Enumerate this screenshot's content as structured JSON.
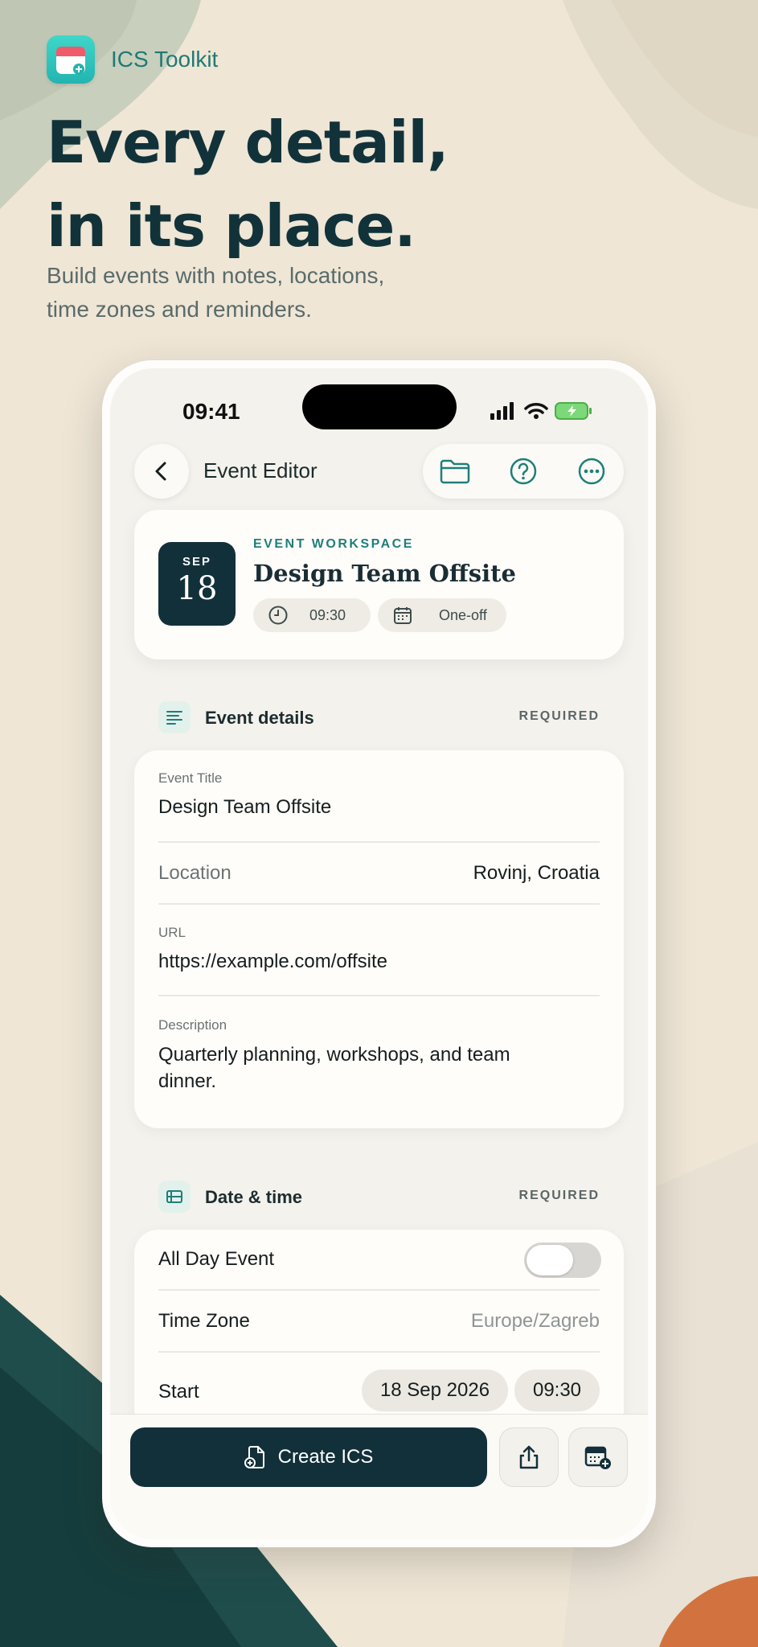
{
  "brand": {
    "name": "ICS Toolkit"
  },
  "headline": {
    "line1": "Every detail,",
    "line2": "in its place."
  },
  "subheadline": {
    "line1": "Build events with notes, locations,",
    "line2": "time zones and reminders."
  },
  "status_bar": {
    "time": "09:41"
  },
  "nav": {
    "title": "Event Editor"
  },
  "hero": {
    "month": "SEP",
    "day": "18",
    "label": "EVENT WORKSPACE",
    "title": "Design Team Offsite",
    "time_chip": "09:30",
    "repeat_chip": "One-off"
  },
  "event_details": {
    "section_title": "Event details",
    "badge": "REQUIRED",
    "title_label": "Event Title",
    "title_value": "Design Team Offsite",
    "location_label": "Location",
    "location_value": "Rovinj, Croatia",
    "url_label": "URL",
    "url_value": "https://example.com/offsite",
    "description_label": "Description",
    "description_line1": "Quarterly planning, workshops, and team",
    "description_line2": "dinner."
  },
  "date_time": {
    "section_title": "Date & time",
    "badge": "REQUIRED",
    "all_day_label": "All Day Event",
    "all_day_on": false,
    "time_zone_label": "Time Zone",
    "time_zone_value": "Europe/Zagreb",
    "start_label": "Start",
    "start_date": "18 Sep 2026",
    "start_time": "09:30"
  },
  "bottom": {
    "create_label": "Create ICS"
  },
  "colors": {
    "accent": "#1e7f79",
    "primary_dark": "#12303a",
    "background": "#efe6d6"
  },
  "icons": [
    "app-icon",
    "back-chevron-icon",
    "folder-icon",
    "help-icon",
    "more-icon",
    "clock-icon",
    "calendar-icon",
    "lines-icon",
    "date-list-icon",
    "document-add-icon",
    "share-icon",
    "calendar-add-icon"
  ]
}
